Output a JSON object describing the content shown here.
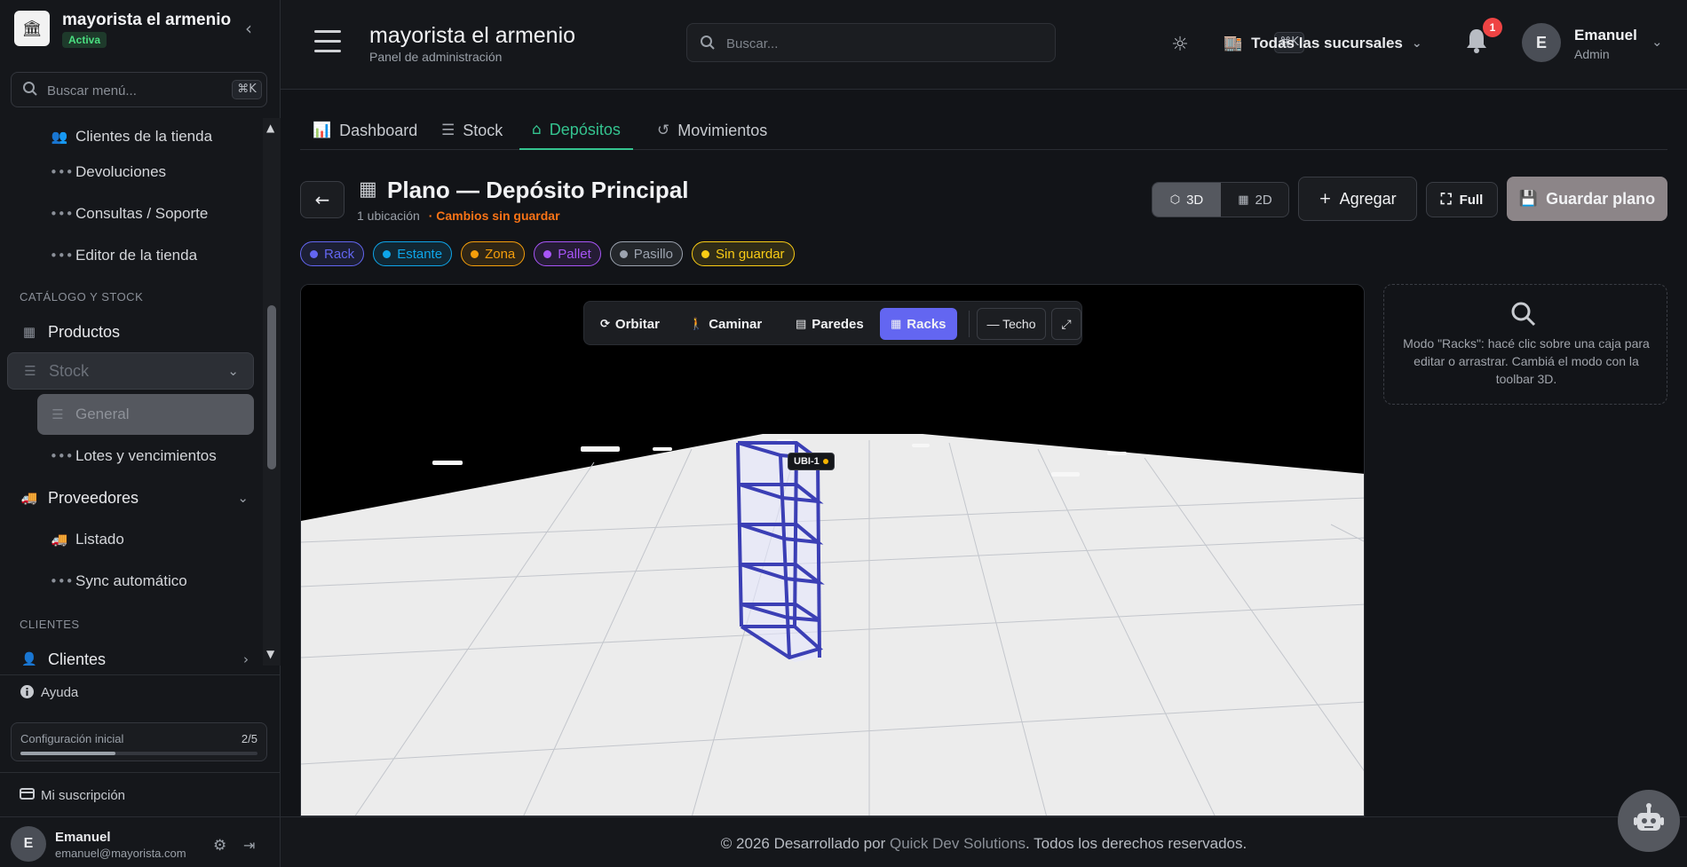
{
  "sidebar": {
    "store_name": "mayorista el armenio",
    "status": "Activa",
    "search_placeholder": "Buscar menú...",
    "shortcut": "⌘K",
    "items_top": [
      {
        "label": "Clientes de la tienda",
        "icon": "users-icon"
      },
      {
        "label": "Devoluciones",
        "icon": "dots-icon"
      },
      {
        "label": "Consultas / Soporte",
        "icon": "dots-icon"
      },
      {
        "label": "Editor de la tienda",
        "icon": "dots-icon"
      }
    ],
    "section_catalog": "CATÁLOGO Y STOCK",
    "productos": "Productos",
    "stock": "Stock",
    "stock_general": "General",
    "stock_lotes": "Lotes y vencimientos",
    "proveedores": "Proveedores",
    "prov_listado": "Listado",
    "prov_sync": "Sync automático",
    "section_clients": "CLIENTES",
    "clientes": "Clientes",
    "help": "Ayuda",
    "config_label": "Configuración inicial",
    "config_count": "2/5",
    "config_progress": 0.4,
    "subscription": "Mi suscripción",
    "user_initial": "E",
    "user_name": "Emanuel",
    "user_email": "emanuel@mayorista.com"
  },
  "topbar": {
    "title": "mayorista el armenio",
    "subtitle": "Panel de administración",
    "search_placeholder": "Buscar...",
    "shortcut": "⌘K",
    "branch": "Todas las sucursales",
    "notifications": "1",
    "user_initial": "E",
    "user_name": "Emanuel",
    "user_role": "Admin"
  },
  "tabs": [
    {
      "label": "Dashboard",
      "icon": "chart-icon"
    },
    {
      "label": "Stock",
      "icon": "list-icon"
    },
    {
      "label": "Depósitos",
      "icon": "warehouse-icon",
      "active": true
    },
    {
      "label": "Movimientos",
      "icon": "history-icon"
    }
  ],
  "plan": {
    "title": "Plano — Depósito Principal",
    "count": "1 ubicación",
    "unsaved": "· Cambios sin guardar"
  },
  "chips": [
    {
      "label": "Rack",
      "color": "#6366f1"
    },
    {
      "label": "Estante",
      "color": "#0ea5e9"
    },
    {
      "label": "Zona",
      "color": "#f59e0b"
    },
    {
      "label": "Pallet",
      "color": "#a855f7"
    },
    {
      "label": "Pasillo",
      "color": "#9ca3af"
    },
    {
      "label": "Sin guardar",
      "color": "#facc15"
    }
  ],
  "view_toggle": {
    "three_d": "3D",
    "two_d": "2D"
  },
  "actions": {
    "add": "Agregar",
    "full": "Full",
    "save": "Guardar plano"
  },
  "toolbar3d": {
    "orbit": "Orbitar",
    "walk": "Caminar",
    "walls": "Paredes",
    "racks": "Racks",
    "roof": "— Techo",
    "expand": "⤢"
  },
  "rack_label": "UBI-1",
  "panel_text": "Modo \"Racks\": hacé clic sobre una caja para editar o arrastrar. Cambiá el modo con la toolbar 3D.",
  "footer": {
    "prefix": "© 2026 Desarrollado por ",
    "link": "Quick Dev Solutions",
    "suffix": ". Todos los derechos reservados."
  },
  "colors": {
    "accent": "#34c38f",
    "racks_active": "#6366f1",
    "unsaved": "#f97316"
  }
}
